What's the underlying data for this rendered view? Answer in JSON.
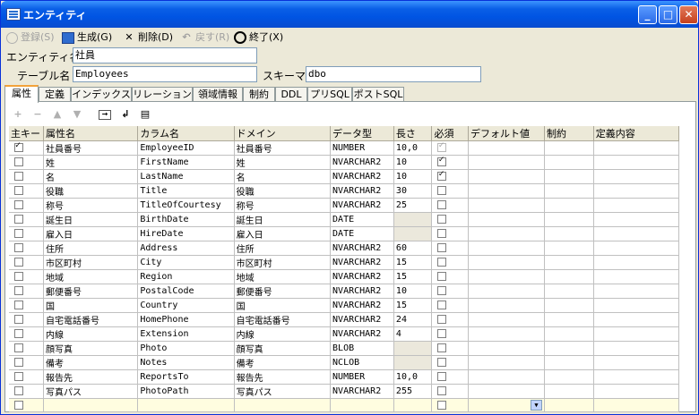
{
  "window": {
    "title": "エンティティ"
  },
  "toolbar": {
    "register": "登録(S)",
    "generate": "生成(G)",
    "delete": "削除(D)",
    "undo": "戻す(R)",
    "finish": "終了(X)"
  },
  "form": {
    "entity_label": "エンティティ名",
    "entity_value": "社員",
    "table_label": "テーブル名",
    "table_value": "Employees",
    "schema_label": "スキーマ",
    "schema_value": "dbo"
  },
  "tabs": [
    "属性",
    "定義",
    "インデックス",
    "リレーション",
    "領域情報",
    "制約",
    "DDL",
    "プリSQL",
    "ポストSQL"
  ],
  "grid": {
    "headers": [
      "主キー",
      "属性名",
      "カラム名",
      "ドメイン",
      "データ型",
      "長さ",
      "必須",
      "デフォルト値",
      "制約",
      "定義内容"
    ],
    "rows": [
      {
        "pk": true,
        "name": "社員番号",
        "column": "EmployeeID",
        "domain": "社員番号",
        "type": "NUMBER",
        "length": "10,0",
        "required": true,
        "req_disabled": true
      },
      {
        "pk": false,
        "name": "姓",
        "column": "FirstName",
        "domain": "姓",
        "type": "NVARCHAR2",
        "length": "10",
        "required": true
      },
      {
        "pk": false,
        "name": "名",
        "column": "LastName",
        "domain": "名",
        "type": "NVARCHAR2",
        "length": "10",
        "required": true
      },
      {
        "pk": false,
        "name": "役職",
        "column": "Title",
        "domain": "役職",
        "type": "NVARCHAR2",
        "length": "30",
        "required": false
      },
      {
        "pk": false,
        "name": "称号",
        "column": "TitleOfCourtesy",
        "domain": "称号",
        "type": "NVARCHAR2",
        "length": "25",
        "required": false
      },
      {
        "pk": false,
        "name": "誕生日",
        "column": "BirthDate",
        "domain": "誕生日",
        "type": "DATE",
        "length": "",
        "required": false
      },
      {
        "pk": false,
        "name": "雇入日",
        "column": "HireDate",
        "domain": "雇入日",
        "type": "DATE",
        "length": "",
        "required": false
      },
      {
        "pk": false,
        "name": "住所",
        "column": "Address",
        "domain": "住所",
        "type": "NVARCHAR2",
        "length": "60",
        "required": false
      },
      {
        "pk": false,
        "name": "市区町村",
        "column": "City",
        "domain": "市区町村",
        "type": "NVARCHAR2",
        "length": "15",
        "required": false
      },
      {
        "pk": false,
        "name": "地域",
        "column": "Region",
        "domain": "地域",
        "type": "NVARCHAR2",
        "length": "15",
        "required": false
      },
      {
        "pk": false,
        "name": "郵便番号",
        "column": "PostalCode",
        "domain": "郵便番号",
        "type": "NVARCHAR2",
        "length": "10",
        "required": false
      },
      {
        "pk": false,
        "name": "国",
        "column": "Country",
        "domain": "国",
        "type": "NVARCHAR2",
        "length": "15",
        "required": false
      },
      {
        "pk": false,
        "name": "自宅電話番号",
        "column": "HomePhone",
        "domain": "自宅電話番号",
        "type": "NVARCHAR2",
        "length": "24",
        "required": false
      },
      {
        "pk": false,
        "name": "内線",
        "column": "Extension",
        "domain": "内線",
        "type": "NVARCHAR2",
        "length": "4",
        "required": false
      },
      {
        "pk": false,
        "name": "顔写真",
        "column": "Photo",
        "domain": "顔写真",
        "type": "BLOB",
        "length": "",
        "required": false
      },
      {
        "pk": false,
        "name": "備考",
        "column": "Notes",
        "domain": "備考",
        "type": "NCLOB",
        "length": "",
        "required": false
      },
      {
        "pk": false,
        "name": "報告先",
        "column": "ReportsTo",
        "domain": "報告先",
        "type": "NUMBER",
        "length": "10,0",
        "required": false
      },
      {
        "pk": false,
        "name": "写真パス",
        "column": "PhotoPath",
        "domain": "写真パス",
        "type": "NVARCHAR2",
        "length": "255",
        "required": false
      }
    ]
  },
  "colors": {
    "titlebar": "#0054e3",
    "new_row": "#fffde0",
    "tab_highlight": "#f2a23a"
  }
}
